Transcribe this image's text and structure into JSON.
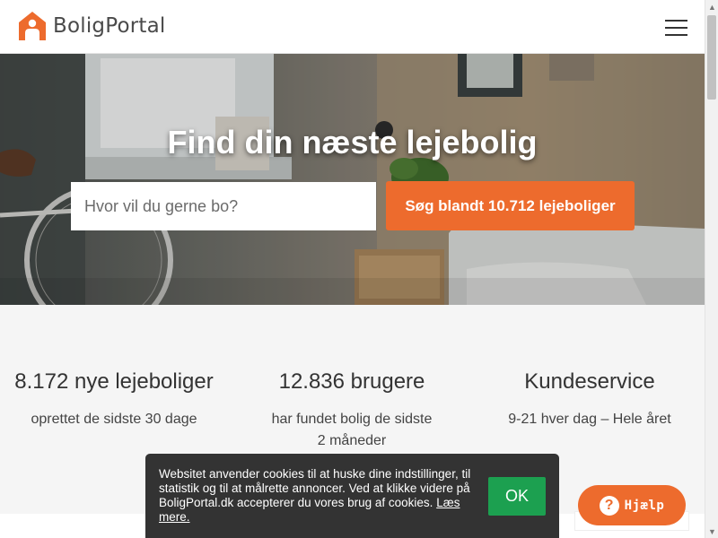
{
  "header": {
    "logo_text": "BoligPortal"
  },
  "hero": {
    "title": "Find din næste lejebolig",
    "search_placeholder": "Hvor vil du gerne bo?",
    "search_button_label": "Søg blandt 10.712 lejeboliger"
  },
  "stats": [
    {
      "title": "8.172 nye lejeboliger",
      "description": "oprettet de sidste 30 dage"
    },
    {
      "title": "12.836 brugere",
      "description": "har fundet bolig de sidste 2 måneder"
    },
    {
      "title": "Kundeservice",
      "description": "9-21 hver dag – Hele året"
    }
  ],
  "cookie": {
    "text": "Websitet anvender cookies til at huske dine indstillinger, til statistik og til at målrette annoncer. Ved at klikke videre på BoligPortal.dk accepterer du vores brug af cookies.",
    "link_label": "Læs mere.",
    "ok_label": "OK"
  },
  "help": {
    "icon_glyph": "?",
    "label": "Hjælp"
  },
  "colors": {
    "brand_orange": "#ed6b2d",
    "ok_green": "#1ca050",
    "cookie_bg": "#333333"
  },
  "icons": [
    "house-person-logo-icon",
    "hamburger-menu-icon",
    "question-mark-icon"
  ]
}
